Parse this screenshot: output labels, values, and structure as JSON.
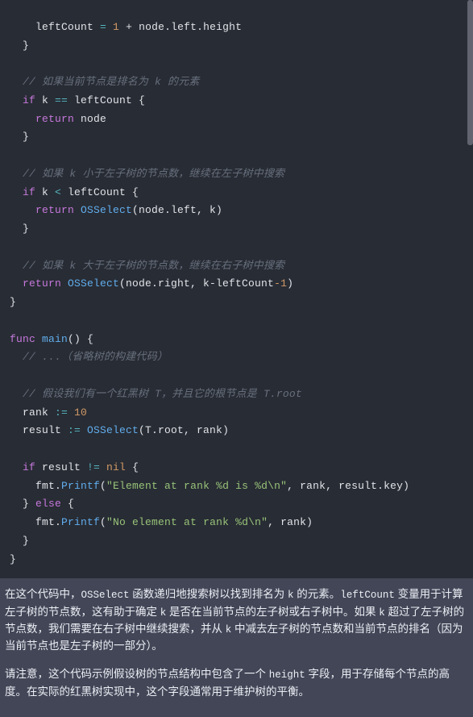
{
  "code": {
    "l1a": "    leftCount ",
    "l1b": "= ",
    "l1c": "1",
    "l1d": " + node.left.height",
    "l2": "  }",
    "l3a": "  // ",
    "l3b": "如果当前节点是排名为 k 的元素",
    "l4a": "  if",
    "l4b": " k ",
    "l4c": "==",
    "l4d": " leftCount {",
    "l5a": "    return",
    "l5b": " node",
    "l6": "  }",
    "l7a": "  // ",
    "l7b": "如果 k 小于左子树的节点数，继续在左子树中搜索",
    "l8a": "  if",
    "l8b": " k ",
    "l8c": "<",
    "l8d": " leftCount {",
    "l9a": "    return",
    "l9b": " OSSelect",
    "l9c": "(node.left, k)",
    "l10": "  }",
    "l11a": "  // ",
    "l11b": "如果 k 大于左子树的节点数，继续在右子树中搜索",
    "l12a": "  return",
    "l12b": " OSSelect",
    "l12c": "(node.right, k-leftCount",
    "l12d": "-1",
    "l12e": ")",
    "l13": "}",
    "l14a": "func",
    "l14b": " main",
    "l14c": "()",
    "l14d": " {",
    "l15a": "  // ",
    "l15b": "...（省略树的构建代码）",
    "l16a": "  // ",
    "l16b": "假设我们有一个红黑树 T，并且它的根节点是 T.root",
    "l17a": "  rank ",
    "l17b": ":=",
    "l17c": " 10",
    "l18a": "  result ",
    "l18b": ":=",
    "l18c": " OSSelect",
    "l18d": "(T.root, rank)",
    "l19a": "  if",
    "l19b": " result ",
    "l19c": "!=",
    "l19d": " nil",
    "l19e": " {",
    "l20a": "    fmt.",
    "l20b": "Printf",
    "l20c": "(",
    "l20d": "\"Element at rank %d is %d\\n\"",
    "l20e": ", rank, result.key)",
    "l21a": "  } ",
    "l21b": "else",
    "l21c": " {",
    "l22a": "    fmt.",
    "l22b": "Printf",
    "l22c": "(",
    "l22d": "\"No element at rank %d\\n\"",
    "l22e": ", rank)",
    "l23": "  }",
    "l24": "}"
  },
  "text": {
    "p1_1": "在这个代码中，",
    "p1_c1": "OSSelect",
    "p1_2": " 函数递归地搜索树以找到排名为 ",
    "p1_c2": "k",
    "p1_3": " 的元素。",
    "p1_c3": "leftCount",
    "p1_4": " 变量用于计算左子树的节点数，这有助于确定 ",
    "p1_c4": "k",
    "p1_5": " 是否在当前节点的左子树或右子树中。如果 ",
    "p1_c5": "k",
    "p1_6": " 超过了左子树的节点数，我们需要在右子树中继续搜索，并从 ",
    "p1_c6": "k",
    "p1_7": " 中减去左子树的节点数和当前节点的排名（因为当前节点也是左子树的一部分）。",
    "p2_1": "请注意，这个代码示例假设树的节点结构中包含了一个 ",
    "p2_c1": "height",
    "p2_2": " 字段，用于存储每个节点的高度。在实际的红黑树实现中，这个字段通常用于维护树的平衡。"
  }
}
